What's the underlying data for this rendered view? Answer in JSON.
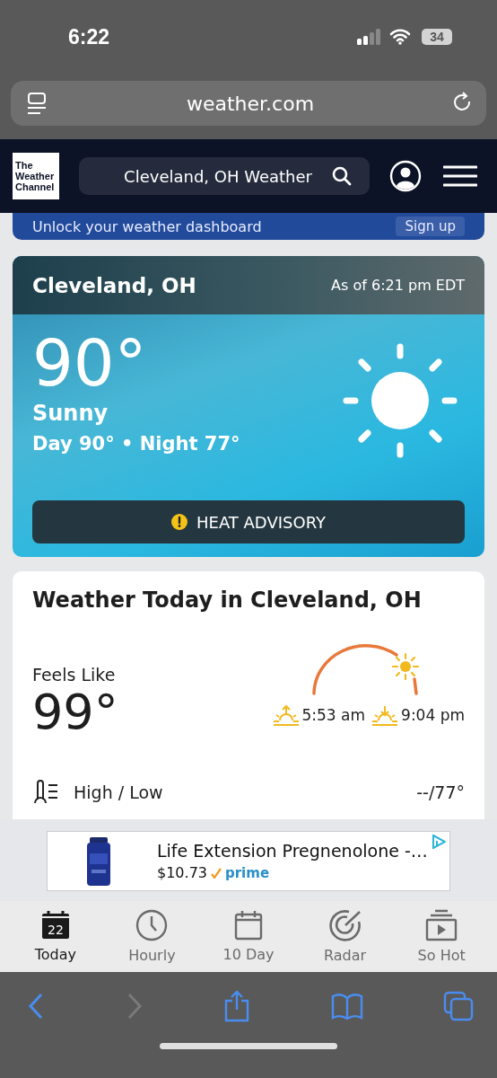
{
  "status_bar": {
    "time": "6:22",
    "battery": "34"
  },
  "address_bar": {
    "url": "weather.com"
  },
  "site_header": {
    "logo_lines": [
      "The",
      "Weather",
      "Channel"
    ],
    "search_value": "Cleveland, OH Weather"
  },
  "promo_banner": {
    "text": "Unlock your weather dashboard",
    "button": "Sign up"
  },
  "current_conditions": {
    "location": "Cleveland, OH",
    "as_of": "As of 6:21 pm EDT",
    "temperature": "90°",
    "condition": "Sunny",
    "day_night": "Day 90° • Night 77°",
    "alert": "HEAT ADVISORY"
  },
  "today_card": {
    "title": "Weather Today in Cleveland, OH",
    "feels_like_label": "Feels Like",
    "feels_like": "99°",
    "sunrise": "5:53 am",
    "sunset": "9:04 pm",
    "rows": [
      {
        "label": "High / Low",
        "value": "--/77°"
      }
    ]
  },
  "ad": {
    "title": "Life Extension Pregnenolone -…",
    "price": "$10.73",
    "badge": "prime"
  },
  "tabs": [
    {
      "label": "Today",
      "kind": "today",
      "day": "22",
      "selected": true
    },
    {
      "label": "Hourly",
      "kind": "hourly",
      "selected": false
    },
    {
      "label": "10 Day",
      "kind": "tenday",
      "selected": false
    },
    {
      "label": "Radar",
      "kind": "radar",
      "selected": false
    },
    {
      "label": "So Hot",
      "kind": "video",
      "selected": false
    }
  ]
}
